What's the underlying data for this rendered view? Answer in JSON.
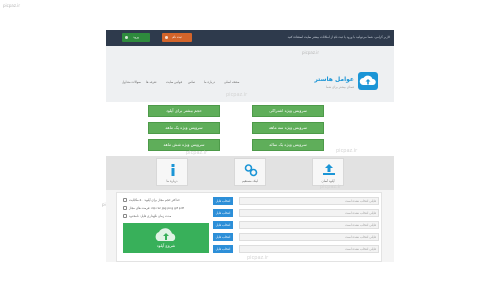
{
  "watermark": {
    "corner_text": "picpaz.ir",
    "center_text": "picpaz.ir"
  },
  "topbar": {
    "notice": "کاربر گرامی، شما می‌توانید با ورود یا ثبت نام از امکانات بیشتر سایت استفاده کنید",
    "login_label": "ورود",
    "register_label": "ثبت نام"
  },
  "header": {
    "logo_title": "عوامل هاستر",
    "logo_subtitle": "فضای بیشتر برای شما",
    "nav": [
      "صفحه اصلی",
      "درباره ما",
      "تماس",
      "قوانین سایت",
      "تعرفه ها",
      "سوالات متداول"
    ]
  },
  "plans": {
    "buttons": [
      "حجم بیشتر برای آپلود",
      "سرویس ویژه اشتراکی",
      "سرویس ویژه یک ماهه",
      "سرویس ویژه سه ماهه",
      "سرویس ویژه شش ماهه",
      "سرویس ویژه یک ساله"
    ]
  },
  "features": {
    "items": [
      {
        "label": "آپلود آسان",
        "icon": "upload-icon"
      },
      {
        "label": "لینک مستقیم",
        "icon": "link-icon"
      },
      {
        "label": "درباره ما",
        "icon": "info-icon"
      }
    ]
  },
  "uploader": {
    "button_label": "انتخاب فایل",
    "left_placeholder": "فایلی انتخاب نشده",
    "right_placeholder": "فایلی انتخاب نشده است",
    "status_lines": [
      "حداکثر حجم مجاز برای آپلود: ۵۰ مگابایت",
      "فرمت های مجاز: zip rar jpg png gif pdf",
      "مدت زمان نگهداری فایل: نامحدود"
    ],
    "upload_label": "شروع آپلود"
  },
  "colors": {
    "topbar": "#2e3a4c",
    "brand": "#1b95d6",
    "plan_green": "#5fae5a",
    "upload_green": "#38b05a",
    "file_button_blue": "#2d8fd8",
    "register_orange": "#d3642a"
  }
}
